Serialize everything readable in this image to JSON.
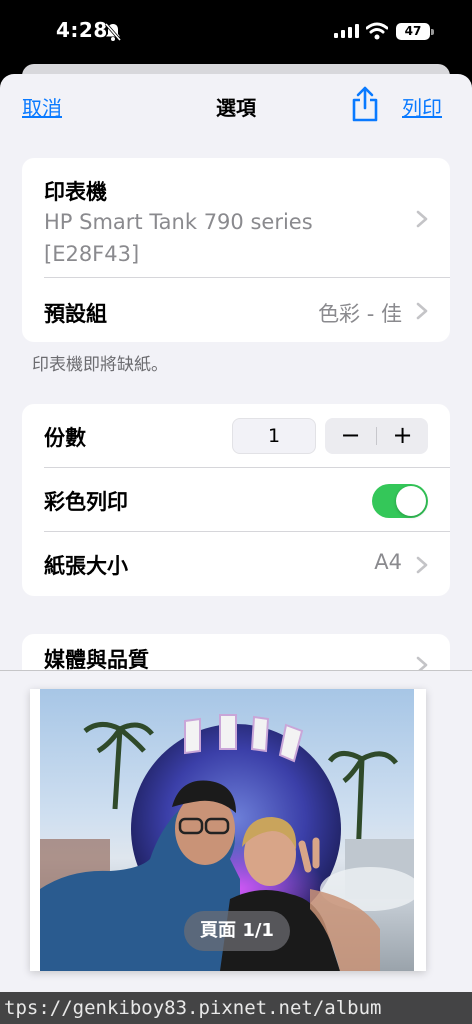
{
  "status_bar": {
    "time": "4:28",
    "battery": "47"
  },
  "nav": {
    "cancel": "取消",
    "title": "選項",
    "print": "列印"
  },
  "printer": {
    "label": "印表機",
    "name": "HP Smart Tank 790 series [E28F43]"
  },
  "preset": {
    "label": "預設組",
    "value": "色彩 - 佳"
  },
  "warning": "印表機即將缺紙。",
  "copies": {
    "label": "份數",
    "value": "1",
    "minus": "−",
    "plus": "+"
  },
  "color_print": {
    "label": "彩色列印",
    "on": true
  },
  "paper_size": {
    "label": "紙張大小",
    "value": "A4"
  },
  "media_quality": {
    "label": "媒體與品質"
  },
  "preview": {
    "page_indicator": "頁面 1/1"
  },
  "watermark": "tps://genkiboy83.pixnet.net/album",
  "colors": {
    "accent": "#0a7aff",
    "toggle_on": "#34c759",
    "background": "#f2f2f7"
  }
}
